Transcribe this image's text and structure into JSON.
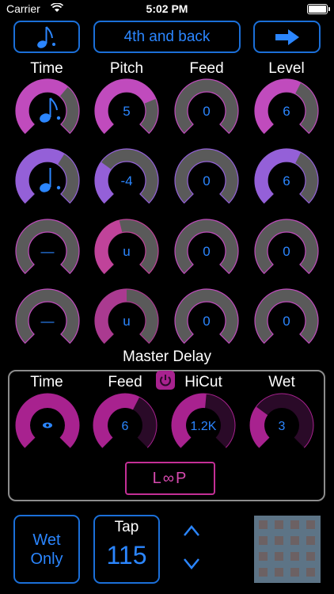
{
  "status": {
    "carrier": "Carrier",
    "time": "5:02 PM"
  },
  "toolbar": {
    "preset_name": "4th and back"
  },
  "columns": [
    "Time",
    "Pitch",
    "Feed",
    "Level"
  ],
  "grid": [
    [
      {
        "type": "note",
        "symbol": "dotted-eighth",
        "fill": 0.65,
        "color": "#c04bbd"
      },
      {
        "type": "value",
        "label": "5",
        "fill": 0.75,
        "color": "#c04bbd"
      },
      {
        "type": "value",
        "label": "0",
        "fill": 0,
        "color": "#c04bbd"
      },
      {
        "type": "value",
        "label": "6",
        "fill": 0.6,
        "color": "#c04bbd"
      }
    ],
    [
      {
        "type": "note",
        "symbol": "dotted-quarter",
        "fill": 0.62,
        "color": "#9460d8"
      },
      {
        "type": "value",
        "label": "-4",
        "fill": 0.3,
        "color": "#9460d8"
      },
      {
        "type": "value",
        "label": "0",
        "fill": 0,
        "color": "#9460d8"
      },
      {
        "type": "value",
        "label": "6",
        "fill": 0.6,
        "color": "#9460d8"
      }
    ],
    [
      {
        "type": "value",
        "label": "—",
        "fill": 0,
        "color": "#c04bbd"
      },
      {
        "type": "value",
        "label": "u",
        "fill": 0.45,
        "color": "#c0439a"
      },
      {
        "type": "value",
        "label": "0",
        "fill": 0,
        "color": "#c04bbd"
      },
      {
        "type": "value",
        "label": "0",
        "fill": 0,
        "color": "#c04bbd"
      }
    ],
    [
      {
        "type": "value",
        "label": "—",
        "fill": 0,
        "color": "#c04bbd"
      },
      {
        "type": "value",
        "label": "u",
        "fill": 0.5,
        "color": "#aa3a90"
      },
      {
        "type": "value",
        "label": "0",
        "fill": 0,
        "color": "#c04bbd"
      },
      {
        "type": "value",
        "label": "0",
        "fill": 0,
        "color": "#c04bbd"
      }
    ]
  ],
  "master": {
    "title": "Master Delay",
    "columns": [
      "Time",
      "Feed",
      "HiCut",
      "Wet"
    ],
    "knobs": [
      {
        "label": "",
        "fill": 1.0,
        "symbol": "eye"
      },
      {
        "label": "6",
        "fill": 0.6
      },
      {
        "label": "1.2K",
        "fill": 0.52
      },
      {
        "label": "3",
        "fill": 0.3
      }
    ],
    "loop_label": "L∞P"
  },
  "bottom": {
    "wet_only_line1": "Wet",
    "wet_only_line2": "Only",
    "tap_label": "Tap",
    "tempo": "115",
    "up": "^",
    "down": "v"
  },
  "colors": {
    "accent": "#2b86ff",
    "border": "#1b6fd8",
    "track": "#5a5a5a",
    "master": "#a8228f",
    "master_bg": "#2a0a28"
  }
}
